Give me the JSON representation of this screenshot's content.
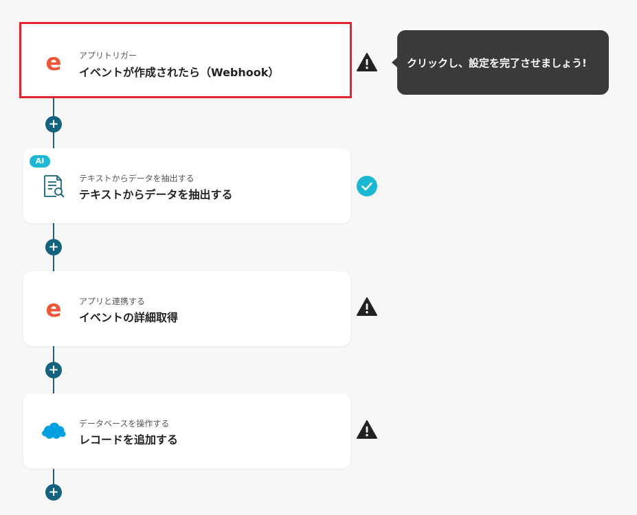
{
  "tooltip": {
    "text": "クリックし、設定を完了させましょう!"
  },
  "steps": [
    {
      "kind": "アプリトリガー",
      "title": "イベントが作成されたら（Webhook）",
      "icon": "eventbrite-icon",
      "status": "warning",
      "selected": true
    },
    {
      "kind": "テキストからデータを抽出する",
      "title": "テキストからデータを抽出する",
      "icon": "document-search-icon",
      "status": "complete",
      "badge": "AI"
    },
    {
      "kind": "アプリと連携する",
      "title": "イベントの詳細取得",
      "icon": "eventbrite-icon",
      "status": "warning"
    },
    {
      "kind": "データベースを操作する",
      "title": "レコードを追加する",
      "icon": "salesforce-icon",
      "status": "warning"
    }
  ],
  "add_button_label": "+",
  "colors": {
    "selected_border": "#e0262c",
    "connector": "#1f5f7a",
    "add_button": "#13627e",
    "ai_badge": "#1bb8d6",
    "check": "#1bb8d6",
    "eventbrite": "#f05537",
    "salesforce": "#00a1e0",
    "tooltip_bg": "#3a3a3a"
  }
}
